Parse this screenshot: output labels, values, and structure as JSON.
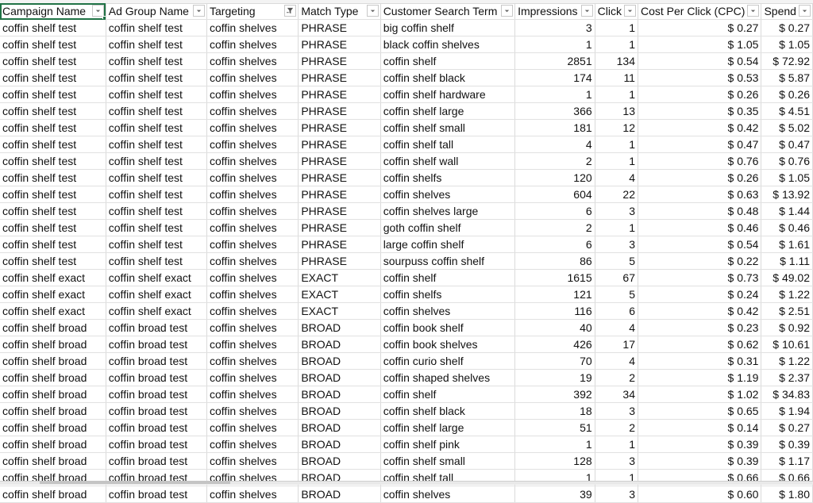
{
  "sheet": {
    "columns": [
      {
        "label": "Campaign Name",
        "filter_icon": "dropdown-arrow-icon",
        "filtered": false
      },
      {
        "label": "Ad Group Name",
        "filter_icon": "dropdown-arrow-icon",
        "filtered": false
      },
      {
        "label": "Targeting",
        "filter_icon": "filter-funnel-icon",
        "filtered": true
      },
      {
        "label": "Match Type",
        "filter_icon": "dropdown-arrow-icon",
        "filtered": false
      },
      {
        "label": "Customer Search Term",
        "filter_icon": "dropdown-arrow-icon",
        "filtered": false
      },
      {
        "label": "Impressions",
        "filter_icon": "dropdown-arrow-icon",
        "filtered": false
      },
      {
        "label": "Click",
        "filter_icon": "dropdown-arrow-icon",
        "filtered": false
      },
      {
        "label": "Cost Per Click (CPC)",
        "filter_icon": "dropdown-arrow-icon",
        "filtered": false
      },
      {
        "label": "Spend",
        "filter_icon": "dropdown-arrow-icon",
        "filtered": false
      }
    ],
    "rows": [
      [
        "coffin shelf test",
        "coffin shelf test",
        "coffin shelves",
        "PHRASE",
        "big coffin shelf",
        "3",
        "1",
        "$ 0.27",
        "$ 0.27"
      ],
      [
        "coffin shelf test",
        "coffin shelf test",
        "coffin shelves",
        "PHRASE",
        "black coffin shelves",
        "1",
        "1",
        "$ 1.05",
        "$ 1.05"
      ],
      [
        "coffin shelf test",
        "coffin shelf test",
        "coffin shelves",
        "PHRASE",
        "coffin shelf",
        "2851",
        "134",
        "$ 0.54",
        "$ 72.92"
      ],
      [
        "coffin shelf test",
        "coffin shelf test",
        "coffin shelves",
        "PHRASE",
        "coffin shelf black",
        "174",
        "11",
        "$ 0.53",
        "$ 5.87"
      ],
      [
        "coffin shelf test",
        "coffin shelf test",
        "coffin shelves",
        "PHRASE",
        "coffin shelf hardware",
        "1",
        "1",
        "$ 0.26",
        "$ 0.26"
      ],
      [
        "coffin shelf test",
        "coffin shelf test",
        "coffin shelves",
        "PHRASE",
        "coffin shelf large",
        "366",
        "13",
        "$ 0.35",
        "$ 4.51"
      ],
      [
        "coffin shelf test",
        "coffin shelf test",
        "coffin shelves",
        "PHRASE",
        "coffin shelf small",
        "181",
        "12",
        "$ 0.42",
        "$ 5.02"
      ],
      [
        "coffin shelf test",
        "coffin shelf test",
        "coffin shelves",
        "PHRASE",
        "coffin shelf tall",
        "4",
        "1",
        "$ 0.47",
        "$ 0.47"
      ],
      [
        "coffin shelf test",
        "coffin shelf test",
        "coffin shelves",
        "PHRASE",
        "coffin shelf wall",
        "2",
        "1",
        "$ 0.76",
        "$ 0.76"
      ],
      [
        "coffin shelf test",
        "coffin shelf test",
        "coffin shelves",
        "PHRASE",
        "coffin shelfs",
        "120",
        "4",
        "$ 0.26",
        "$ 1.05"
      ],
      [
        "coffin shelf test",
        "coffin shelf test",
        "coffin shelves",
        "PHRASE",
        "coffin shelves",
        "604",
        "22",
        "$ 0.63",
        "$ 13.92"
      ],
      [
        "coffin shelf test",
        "coffin shelf test",
        "coffin shelves",
        "PHRASE",
        "coffin shelves large",
        "6",
        "3",
        "$ 0.48",
        "$ 1.44"
      ],
      [
        "coffin shelf test",
        "coffin shelf test",
        "coffin shelves",
        "PHRASE",
        "goth coffin shelf",
        "2",
        "1",
        "$ 0.46",
        "$ 0.46"
      ],
      [
        "coffin shelf test",
        "coffin shelf test",
        "coffin shelves",
        "PHRASE",
        "large coffin shelf",
        "6",
        "3",
        "$ 0.54",
        "$ 1.61"
      ],
      [
        "coffin shelf test",
        "coffin shelf test",
        "coffin shelves",
        "PHRASE",
        "sourpuss coffin shelf",
        "86",
        "5",
        "$ 0.22",
        "$ 1.11"
      ],
      [
        "coffin shelf exact",
        "coffin shelf exact",
        "coffin shelves",
        "EXACT",
        "coffin shelf",
        "1615",
        "67",
        "$ 0.73",
        "$ 49.02"
      ],
      [
        "coffin shelf exact",
        "coffin shelf exact",
        "coffin shelves",
        "EXACT",
        "coffin shelfs",
        "121",
        "5",
        "$ 0.24",
        "$ 1.22"
      ],
      [
        "coffin shelf exact",
        "coffin shelf exact",
        "coffin shelves",
        "EXACT",
        "coffin shelves",
        "116",
        "6",
        "$ 0.42",
        "$ 2.51"
      ],
      [
        "coffin shelf broad",
        "coffin broad test",
        "coffin shelves",
        "BROAD",
        "coffin book shelf",
        "40",
        "4",
        "$ 0.23",
        "$ 0.92"
      ],
      [
        "coffin shelf broad",
        "coffin broad test",
        "coffin shelves",
        "BROAD",
        "coffin book shelves",
        "426",
        "17",
        "$ 0.62",
        "$ 10.61"
      ],
      [
        "coffin shelf broad",
        "coffin broad test",
        "coffin shelves",
        "BROAD",
        "coffin curio shelf",
        "70",
        "4",
        "$ 0.31",
        "$ 1.22"
      ],
      [
        "coffin shelf broad",
        "coffin broad test",
        "coffin shelves",
        "BROAD",
        "coffin shaped shelves",
        "19",
        "2",
        "$ 1.19",
        "$ 2.37"
      ],
      [
        "coffin shelf broad",
        "coffin broad test",
        "coffin shelves",
        "BROAD",
        "coffin shelf",
        "392",
        "34",
        "$ 1.02",
        "$ 34.83"
      ],
      [
        "coffin shelf broad",
        "coffin broad test",
        "coffin shelves",
        "BROAD",
        "coffin shelf black",
        "18",
        "3",
        "$ 0.65",
        "$ 1.94"
      ],
      [
        "coffin shelf broad",
        "coffin broad test",
        "coffin shelves",
        "BROAD",
        "coffin shelf large",
        "51",
        "2",
        "$ 0.14",
        "$ 0.27"
      ],
      [
        "coffin shelf broad",
        "coffin broad test",
        "coffin shelves",
        "BROAD",
        "coffin shelf pink",
        "1",
        "1",
        "$ 0.39",
        "$ 0.39"
      ],
      [
        "coffin shelf broad",
        "coffin broad test",
        "coffin shelves",
        "BROAD",
        "coffin shelf small",
        "128",
        "3",
        "$ 0.39",
        "$ 1.17"
      ],
      [
        "coffin shelf broad",
        "coffin broad test",
        "coffin shelves",
        "BROAD",
        "coffin shelf tall",
        "1",
        "1",
        "$ 0.66",
        "$ 0.66"
      ],
      [
        "coffin shelf broad",
        "coffin broad test",
        "coffin shelves",
        "BROAD",
        "coffin shelves",
        "39",
        "3",
        "$ 0.60",
        "$ 1.80"
      ]
    ],
    "selected_cell": "Campaign Name",
    "accent_color": "#217346"
  }
}
